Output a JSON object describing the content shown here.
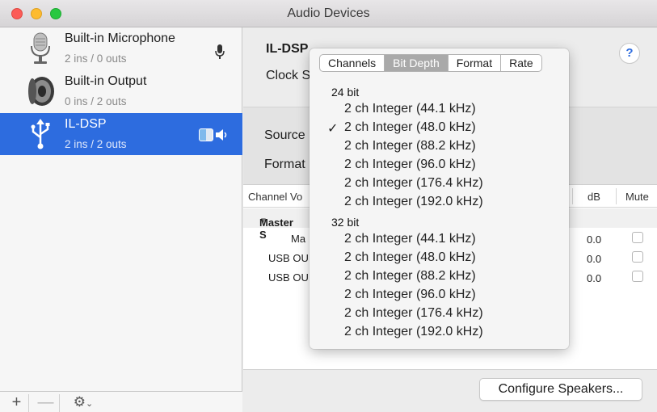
{
  "window": {
    "title": "Audio Devices"
  },
  "devices": [
    {
      "name": "Built-in Microphone",
      "io": "2 ins / 0 outs",
      "icon": "microphone-icon"
    },
    {
      "name": "Built-in Output",
      "io": "0 ins / 2 outs",
      "icon": "speaker-icon"
    },
    {
      "name": "IL-DSP",
      "io": "2 ins / 2 outs",
      "icon": "usb-icon"
    }
  ],
  "footer": {
    "add": "+",
    "remove": "—",
    "gear": "⚙"
  },
  "main": {
    "device_title": "IL-DSP",
    "clock_label": "Clock S",
    "help": "?",
    "source_label": "Source",
    "format_label": "Format",
    "config_button": "Configure Speakers..."
  },
  "table": {
    "col_channel": "Channel Vo",
    "col_db": "dB",
    "col_mute": "Mute",
    "group": "Master S",
    "rows": [
      {
        "name": "Ma",
        "db": "0.0"
      },
      {
        "name": "USB OU",
        "db": "0.0"
      },
      {
        "name": "USB OU",
        "db": "0.0"
      }
    ]
  },
  "popover": {
    "tabs": [
      "Channels",
      "Bit Depth",
      "Format",
      "Rate"
    ],
    "active_tab": "Bit Depth",
    "check_mark": "✓",
    "groups": [
      {
        "label": "24 bit",
        "options": [
          "2 ch Integer (44.1 kHz)",
          "2 ch Integer (48.0 kHz)",
          "2 ch Integer (88.2 kHz)",
          "2 ch Integer (96.0 kHz)",
          "2 ch Integer (176.4 kHz)",
          "2 ch Integer (192.0 kHz)"
        ]
      },
      {
        "label": "32 bit",
        "options": [
          "2 ch Integer (44.1 kHz)",
          "2 ch Integer (48.0 kHz)",
          "2 ch Integer (88.2 kHz)",
          "2 ch Integer (96.0 kHz)",
          "2 ch Integer (176.4 kHz)",
          "2 ch Integer (192.0 kHz)"
        ]
      }
    ],
    "selected": "2 ch Integer (48.0 kHz)"
  }
}
